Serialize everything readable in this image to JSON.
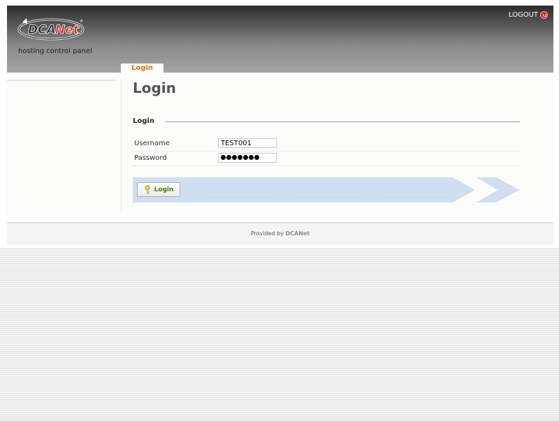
{
  "header": {
    "logo_text": "DCANet",
    "tagline": "hosting control panel",
    "logout_label": "LOGOUT"
  },
  "tabs": [
    {
      "label": "Login",
      "active": true
    }
  ],
  "main": {
    "title": "Login",
    "section_title": "Login",
    "fields": {
      "username": {
        "label": "Username",
        "value": "TEST001"
      },
      "password": {
        "label": "Password",
        "masked_length": 7
      }
    },
    "login_button_label": "Login"
  },
  "footer": {
    "prefix": "Provided by",
    "brand": "DCANet"
  },
  "colors": {
    "tab_accent": "#e06a00",
    "rule_blue": "#7fa6d6",
    "action_bar": "#cfdff0",
    "logout_red": "#d0241b",
    "button_text_green": "#3b7a12"
  },
  "icons": {
    "logout": "power-icon",
    "login_button": "key-icon"
  }
}
